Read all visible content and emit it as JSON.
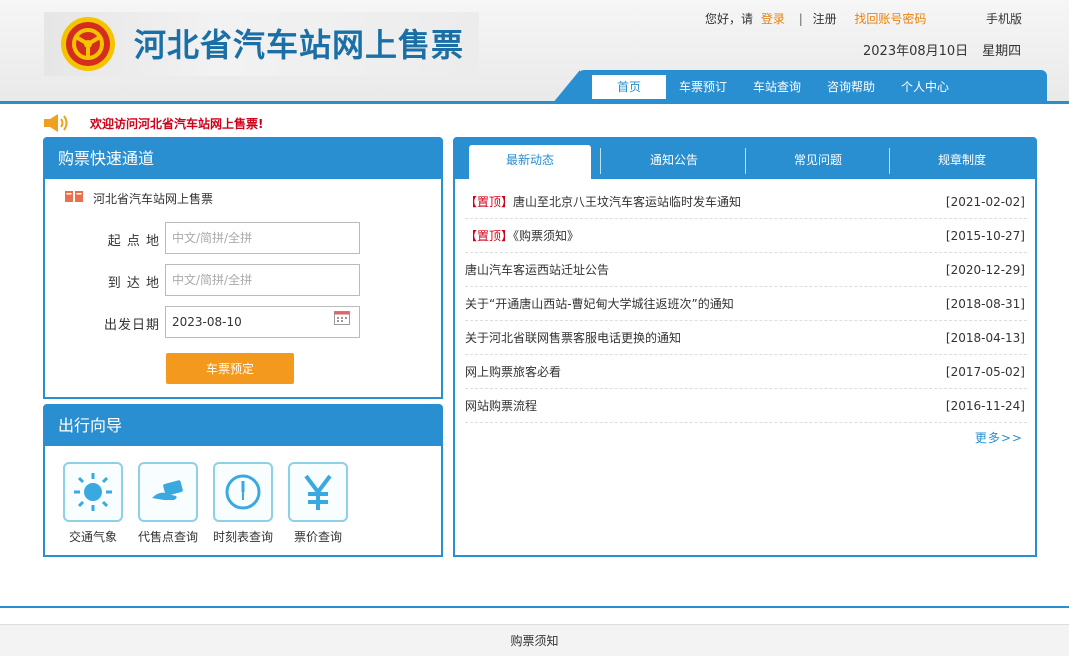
{
  "header": {
    "site_title": "河北省汽车站网上售票",
    "greeting": "您好，请",
    "login": "登录",
    "register": "注册",
    "recover": "找回账号密码",
    "mobile": "手机版",
    "date": "2023年08月10日",
    "weekday": "星期四"
  },
  "nav": [
    {
      "label": "首页",
      "active": true
    },
    {
      "label": "车票预订"
    },
    {
      "label": "车站查询"
    },
    {
      "label": "咨询帮助"
    },
    {
      "label": "个人中心"
    }
  ],
  "welcome": "欢迎访问河北省汽车站网上售票!",
  "ticket": {
    "title": "购票快速通道",
    "subtitle": "河北省汽车站网上售票",
    "from_label": "起 点 地",
    "from_placeholder": "中文/简拼/全拼",
    "to_label": "到 达 地",
    "to_placeholder": "中文/简拼/全拼",
    "date_label": "出发日期",
    "date_value": "2023-08-10",
    "submit": "车票预定"
  },
  "guide": {
    "title": "出行向导",
    "items": [
      {
        "label": "交通气象",
        "icon": "sun-icon"
      },
      {
        "label": "代售点查询",
        "icon": "ticket-hand-icon"
      },
      {
        "label": "时刻表查询",
        "icon": "clock-icon"
      },
      {
        "label": "票价查询",
        "icon": "yen-icon"
      }
    ]
  },
  "news": {
    "tabs": [
      "最新动态",
      "通知公告",
      "常见问题",
      "规章制度"
    ],
    "items": [
      {
        "tag": "【置顶】",
        "title": "唐山至北京八王坟汽车客运站临时发车通知",
        "date": "[2021-02-02]"
      },
      {
        "tag": "【置顶】",
        "title": "《购票须知》",
        "date": "[2015-10-27]"
      },
      {
        "tag": "",
        "title": "唐山汽车客运西站迁址公告",
        "date": "[2020-12-29]"
      },
      {
        "tag": "",
        "title": "关于“开通唐山西站-曹妃甸大学城往返班次”的通知",
        "date": "[2018-08-31]"
      },
      {
        "tag": "",
        "title": "关于河北省联网售票客服电话更换的通知",
        "date": "[2018-04-13]"
      },
      {
        "tag": "",
        "title": "网上购票旅客必看",
        "date": "[2017-05-02]"
      },
      {
        "tag": "",
        "title": "网站购票流程",
        "date": "[2016-11-24]"
      }
    ],
    "more": "更多>>"
  },
  "footer": {
    "text": "购票须知"
  },
  "colors": {
    "primary": "#2a8fd0",
    "accent": "#f39a1e",
    "alert": "#d0021b"
  }
}
